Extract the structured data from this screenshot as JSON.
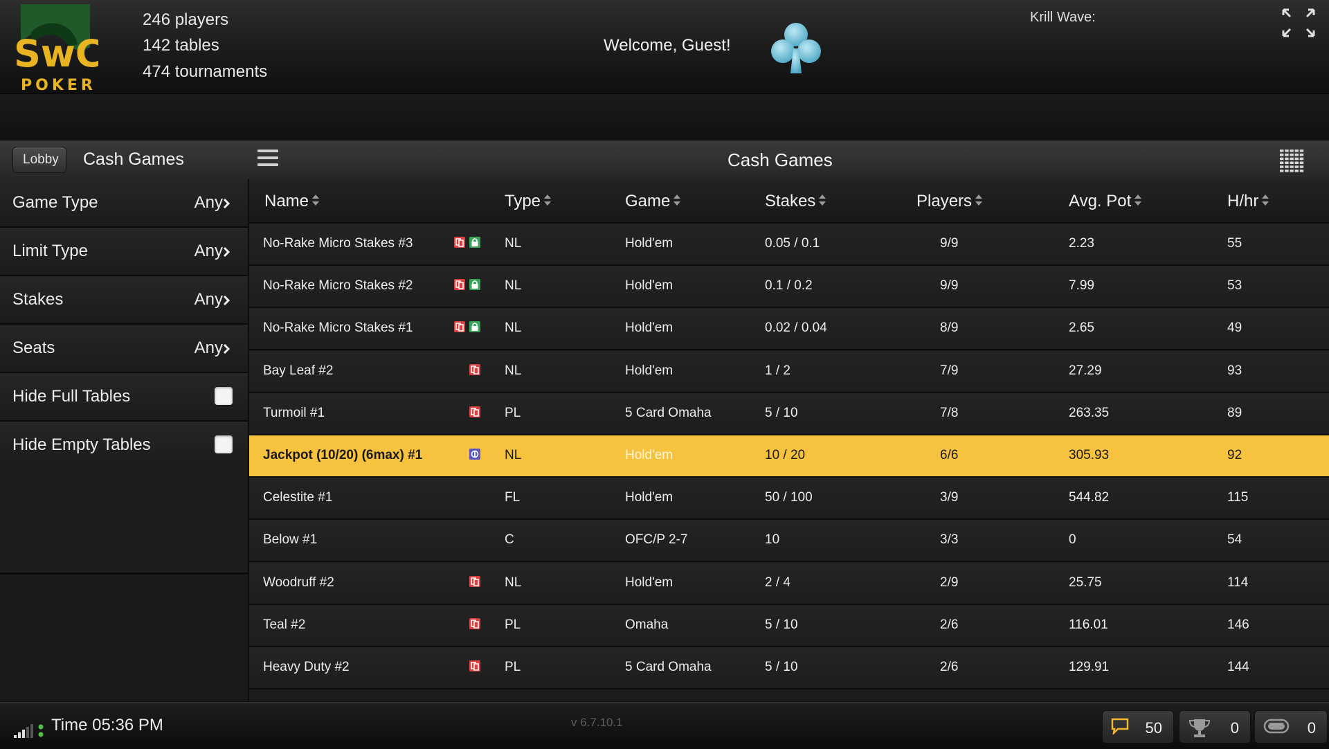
{
  "header": {
    "logo_text": "SwC",
    "logo_sub": "POKER",
    "players": "246 players",
    "tables": "142 tables",
    "tournaments": "474 tournaments",
    "welcome": "Welcome, Guest!",
    "krill_wave": "Krill Wave:"
  },
  "titlebar": {
    "lobby": "Lobby",
    "sidebar_title": "Cash Games",
    "main_title": "Cash Games"
  },
  "filters": [
    {
      "label": "Game Type",
      "value": "Any"
    },
    {
      "label": "Limit Type",
      "value": "Any"
    },
    {
      "label": "Stakes",
      "value": "Any"
    },
    {
      "label": "Seats",
      "value": "Any"
    },
    {
      "label": "Hide Full Tables",
      "checked": false
    },
    {
      "label": "Hide Empty Tables",
      "checked": false
    }
  ],
  "columns": [
    "Name",
    "Type",
    "Game",
    "Stakes",
    "Players",
    "Avg. Pot",
    "H/hr"
  ],
  "rows": [
    {
      "name": "No-Rake Micro Stakes #3",
      "icons": [
        "card-icon",
        "lock-icon"
      ],
      "type": "NL",
      "game": "Hold'em",
      "stakes": "0.05 / 0.1",
      "players": "9/9",
      "avg_pot": "2.23",
      "hhr": "55"
    },
    {
      "name": "No-Rake Micro Stakes #2",
      "icons": [
        "card-icon",
        "lock-icon"
      ],
      "type": "NL",
      "game": "Hold'em",
      "stakes": "0.1 / 0.2",
      "players": "9/9",
      "avg_pot": "7.99",
      "hhr": "53"
    },
    {
      "name": "No-Rake Micro Stakes #1",
      "icons": [
        "card-icon",
        "lock-icon"
      ],
      "type": "NL",
      "game": "Hold'em",
      "stakes": "0.02 / 0.04",
      "players": "8/9",
      "avg_pot": "2.65",
      "hhr": "49"
    },
    {
      "name": "Bay Leaf #2",
      "icons": [
        "card-icon"
      ],
      "type": "NL",
      "game": "Hold'em",
      "stakes": "1 / 2",
      "players": "7/9",
      "avg_pot": "27.29",
      "hhr": "93"
    },
    {
      "name": "Turmoil #1",
      "icons": [
        "card-icon"
      ],
      "type": "PL",
      "game": "5 Card Omaha",
      "stakes": "5 / 10",
      "players": "7/8",
      "avg_pot": "263.35",
      "hhr": "89"
    },
    {
      "name": "Jackpot (10/20) (6max) #1",
      "icons": [
        "jackpot-icon"
      ],
      "type": "NL",
      "game": "Hold'em",
      "stakes": "10 / 20",
      "players": "6/6",
      "avg_pot": "305.93",
      "hhr": "92",
      "selected": true
    },
    {
      "name": "Celestite #1",
      "icons": [],
      "type": "FL",
      "game": "Hold'em",
      "stakes": "50 / 100",
      "players": "3/9",
      "avg_pot": "544.82",
      "hhr": "115"
    },
    {
      "name": "Below #1",
      "icons": [],
      "type": "C",
      "game": "OFC/P 2-7",
      "stakes": "10",
      "players": "3/3",
      "avg_pot": "0",
      "hhr": "54"
    },
    {
      "name": "Woodruff #2",
      "icons": [
        "card-icon"
      ],
      "type": "NL",
      "game": "Hold'em",
      "stakes": "2 / 4",
      "players": "2/9",
      "avg_pot": "25.75",
      "hhr": "114"
    },
    {
      "name": "Teal #2",
      "icons": [
        "card-icon"
      ],
      "type": "PL",
      "game": "Omaha",
      "stakes": "5 / 10",
      "players": "2/6",
      "avg_pot": "116.01",
      "hhr": "146"
    },
    {
      "name": "Heavy Duty #2",
      "icons": [
        "card-icon"
      ],
      "type": "PL",
      "game": "5 Card Omaha",
      "stakes": "5 / 10",
      "players": "2/6",
      "avg_pot": "129.91",
      "hhr": "144"
    }
  ],
  "footer": {
    "time": "Time 05:36 PM",
    "version": "v 6.7.10.1",
    "chat_count": "50",
    "tournament_count": "0",
    "table_count": "0"
  },
  "colors": {
    "selected_row": "#f7c33f",
    "logo_green": "#1f5a2a",
    "logo_gold": "#e8b422",
    "club": "#6fc3dc"
  }
}
